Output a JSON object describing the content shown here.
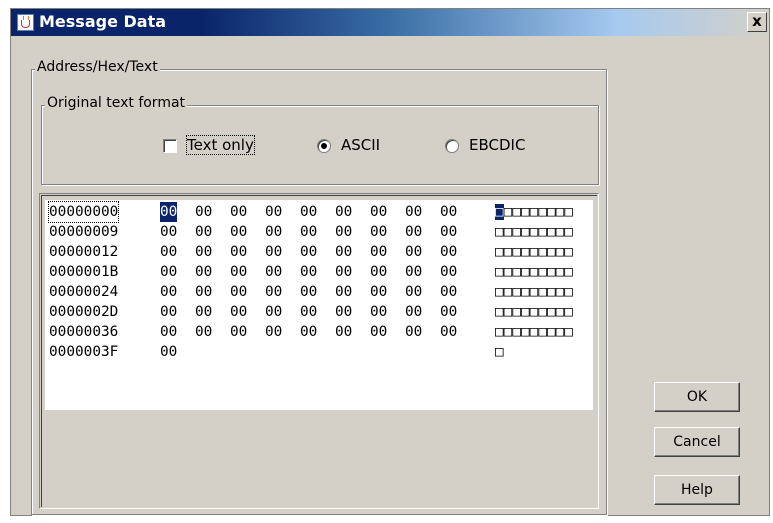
{
  "window": {
    "title": "Message Data",
    "close_glyph": "x",
    "icon": "java-cup-icon"
  },
  "address_group": {
    "label": "Address/Hex/Text"
  },
  "format_group": {
    "label": "Original text format",
    "text_only_label": "Text only",
    "text_only_checked": false,
    "ascii_label": "ASCII",
    "ascii_selected": true,
    "ebcdic_label": "EBCDIC",
    "ebcdic_selected": false
  },
  "hex_view": {
    "rows": [
      {
        "address": "00000000",
        "bytes": [
          "00",
          "00",
          "00",
          "00",
          "00",
          "00",
          "00",
          "00",
          "00"
        ],
        "text": "□□□□□□□□□"
      },
      {
        "address": "00000009",
        "bytes": [
          "00",
          "00",
          "00",
          "00",
          "00",
          "00",
          "00",
          "00",
          "00"
        ],
        "text": "□□□□□□□□□"
      },
      {
        "address": "00000012",
        "bytes": [
          "00",
          "00",
          "00",
          "00",
          "00",
          "00",
          "00",
          "00",
          "00"
        ],
        "text": "□□□□□□□□□"
      },
      {
        "address": "0000001B",
        "bytes": [
          "00",
          "00",
          "00",
          "00",
          "00",
          "00",
          "00",
          "00",
          "00"
        ],
        "text": "□□□□□□□□□"
      },
      {
        "address": "00000024",
        "bytes": [
          "00",
          "00",
          "00",
          "00",
          "00",
          "00",
          "00",
          "00",
          "00"
        ],
        "text": "□□□□□□□□□"
      },
      {
        "address": "0000002D",
        "bytes": [
          "00",
          "00",
          "00",
          "00",
          "00",
          "00",
          "00",
          "00",
          "00"
        ],
        "text": "□□□□□□□□□"
      },
      {
        "address": "00000036",
        "bytes": [
          "00",
          "00",
          "00",
          "00",
          "00",
          "00",
          "00",
          "00",
          "00"
        ],
        "text": "□□□□□□□□□"
      },
      {
        "address": "0000003F",
        "bytes": [
          "00"
        ],
        "text": "□"
      }
    ],
    "selected_row": 0,
    "selected_byte": 0
  },
  "buttons": {
    "ok": "OK",
    "cancel": "Cancel",
    "help": "Help"
  },
  "colors": {
    "title_bar": "#0a246a",
    "selection": "#0a246a",
    "dialog_face": "#d4d0c8"
  }
}
